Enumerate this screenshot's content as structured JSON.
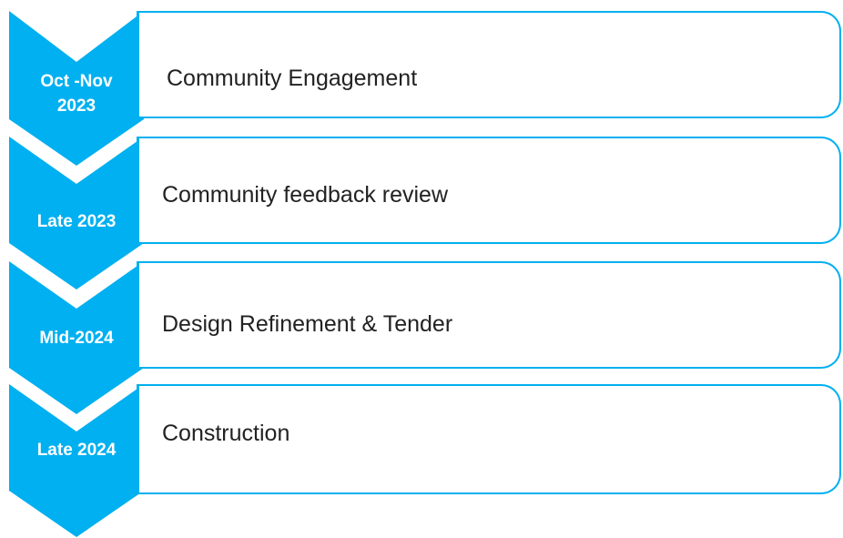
{
  "colors": {
    "chevron_fill": "#00b0f0",
    "box_border": "#00b0f0",
    "chevron_text": "#ffffff",
    "box_text": "#222222"
  },
  "stages": [
    {
      "period": "Oct -Nov\n2023",
      "activity": "Community Engagement"
    },
    {
      "period": "Late 2023",
      "activity": "Community feedback review"
    },
    {
      "period": "Mid-2024",
      "activity": "Design Refinement & Tender"
    },
    {
      "period": "Late 2024",
      "activity": "Construction"
    }
  ]
}
